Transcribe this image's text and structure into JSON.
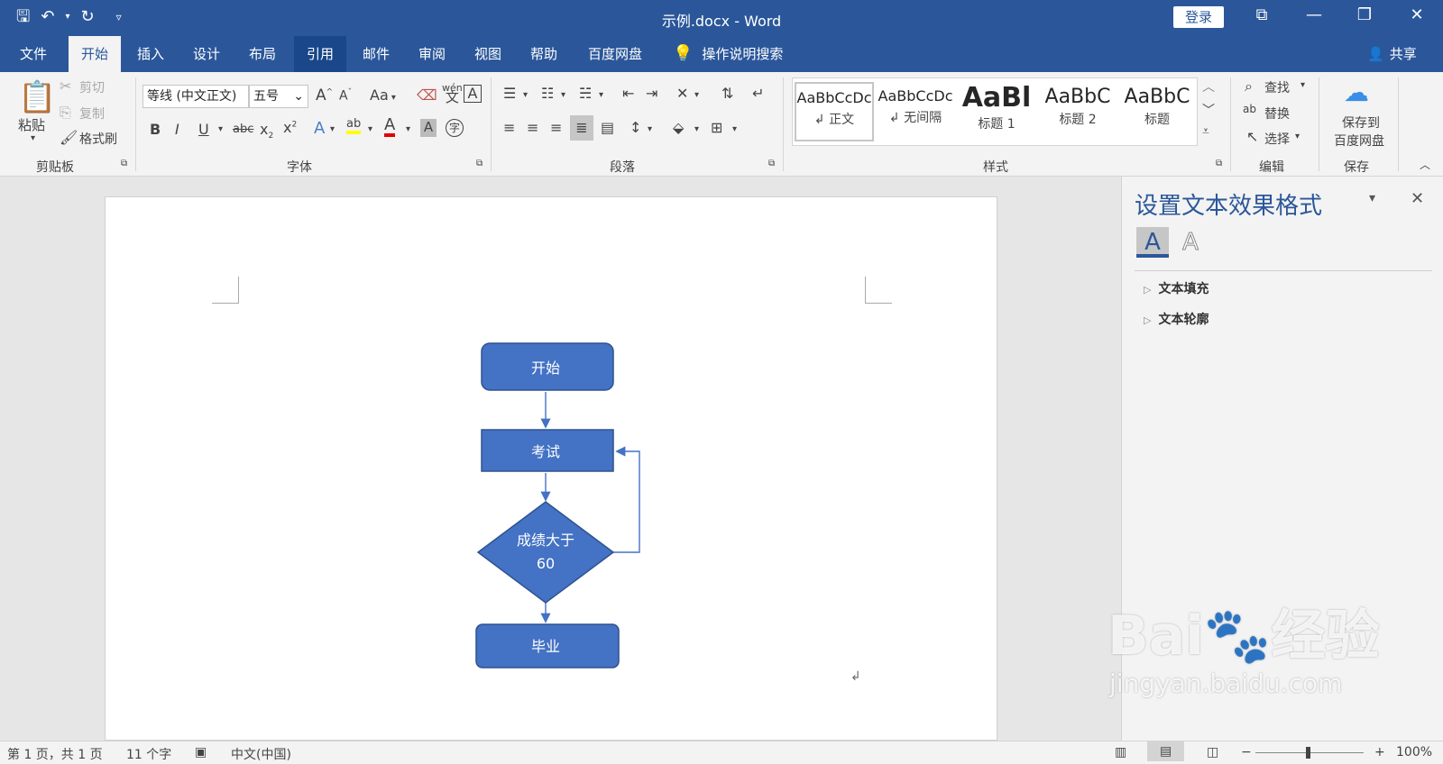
{
  "window": {
    "title": "示例.docx  -  Word",
    "login": "登录"
  },
  "tabs": [
    "文件",
    "开始",
    "插入",
    "设计",
    "布局",
    "引用",
    "邮件",
    "审阅",
    "视图",
    "帮助",
    "百度网盘"
  ],
  "tell_me": "操作说明搜索",
  "share": "共享",
  "clipboard": {
    "paste": "粘贴",
    "cut": "剪切",
    "copy": "复制",
    "format_painter": "格式刷",
    "label": "剪贴板"
  },
  "font": {
    "family": "等线 (中文正文)",
    "size": "五号",
    "label": "字体",
    "aa": "Aa",
    "wen_ruby": "wén",
    "wen_char": "文",
    "boxed_a": "A"
  },
  "paragraph": {
    "label": "段落"
  },
  "styles": {
    "label": "样式",
    "items": [
      {
        "sample": "AaBbCcDc",
        "name": "↲ 正文"
      },
      {
        "sample": "AaBbCcDc",
        "name": "↲ 无间隔"
      },
      {
        "sample": "AaBl",
        "name": "标题 1"
      },
      {
        "sample": "AaBbC",
        "name": "标题 2"
      },
      {
        "sample": "AaBbC",
        "name": "标题"
      }
    ]
  },
  "editing": {
    "find": "查找",
    "replace": "替换",
    "select": "选择",
    "label": "编辑"
  },
  "save": {
    "line1": "保存到",
    "line2": "百度网盘",
    "label": "保存"
  },
  "flowchart": {
    "start": "开始",
    "exam": "考试",
    "decision_line1": "成绩大于",
    "decision_line2": "60",
    "graduate": "毕业"
  },
  "pane": {
    "title": "设置文本效果格式",
    "text_fill": "文本填充",
    "text_outline": "文本轮廓",
    "tab_fill_icon": "A",
    "tab_outline_icon": "A"
  },
  "status": {
    "page": "第 1 页，共 1 页",
    "words": "11 个字",
    "language": "中文(中国)",
    "zoom": "100%"
  },
  "watermark": {
    "brand": "Bai",
    "brand2": "经验",
    "url": "jingyan.baidu.com"
  },
  "colors": {
    "title_blue": "#2b579a",
    "shape_fill": "#4472c4",
    "shape_border": "#2f528f"
  }
}
